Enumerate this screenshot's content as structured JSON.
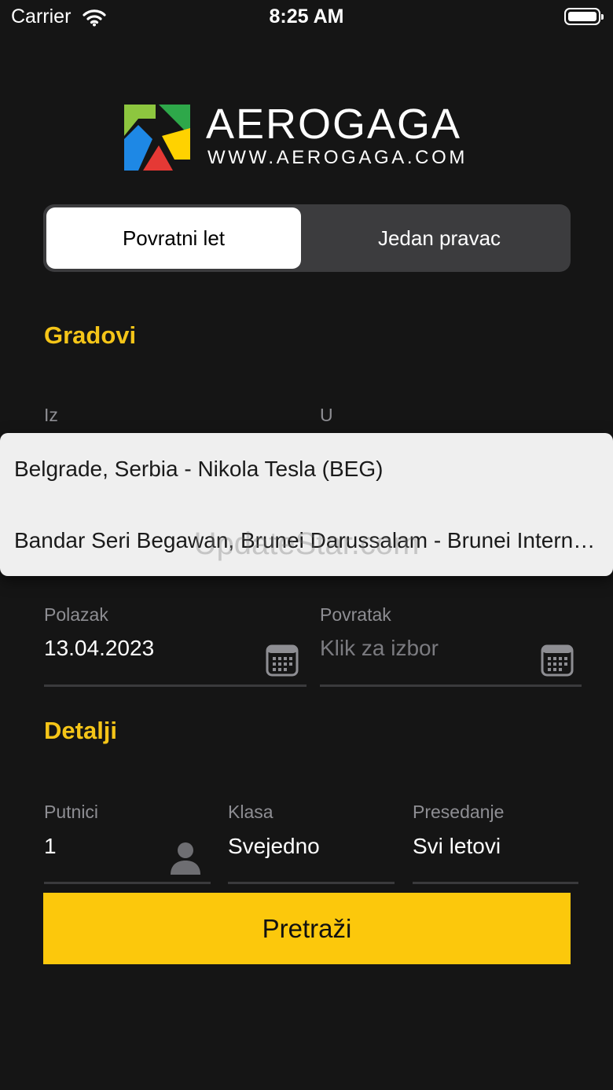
{
  "status_bar": {
    "carrier": "Carrier",
    "time": "8:25 AM"
  },
  "logo": {
    "name": "AEROGAGA",
    "url": "WWW.AEROGAGA.COM"
  },
  "trip_type": {
    "round_trip": "Povratni let",
    "one_way": "Jedan pravac",
    "selected": "round_trip"
  },
  "cities": {
    "title": "Gradovi",
    "from_label": "Iz",
    "to_label": "U",
    "suggestions": [
      "Belgrade, Serbia - Nikola Tesla (BEG)",
      "Bandar Seri Begawan, Brunei Darussalam - Brunei International (BWN)"
    ]
  },
  "watermark": "UpdateStar.com",
  "dates": {
    "departure_label": "Polazak",
    "departure_value": "13.04.2023",
    "return_label": "Povratak",
    "return_placeholder": "Klik za izbor"
  },
  "details": {
    "title": "Detalji",
    "passengers_label": "Putnici",
    "passengers_value": "1",
    "class_label": "Klasa",
    "class_value": "Svejedno",
    "stops_label": "Presedanje",
    "stops_value": "Svi letovi"
  },
  "search_button": "Pretraži",
  "colors": {
    "accent": "#f5c518",
    "button": "#fcc80c",
    "background": "#151515"
  },
  "icons": [
    "wifi-icon",
    "battery-icon",
    "calendar-icon",
    "person-icon"
  ]
}
